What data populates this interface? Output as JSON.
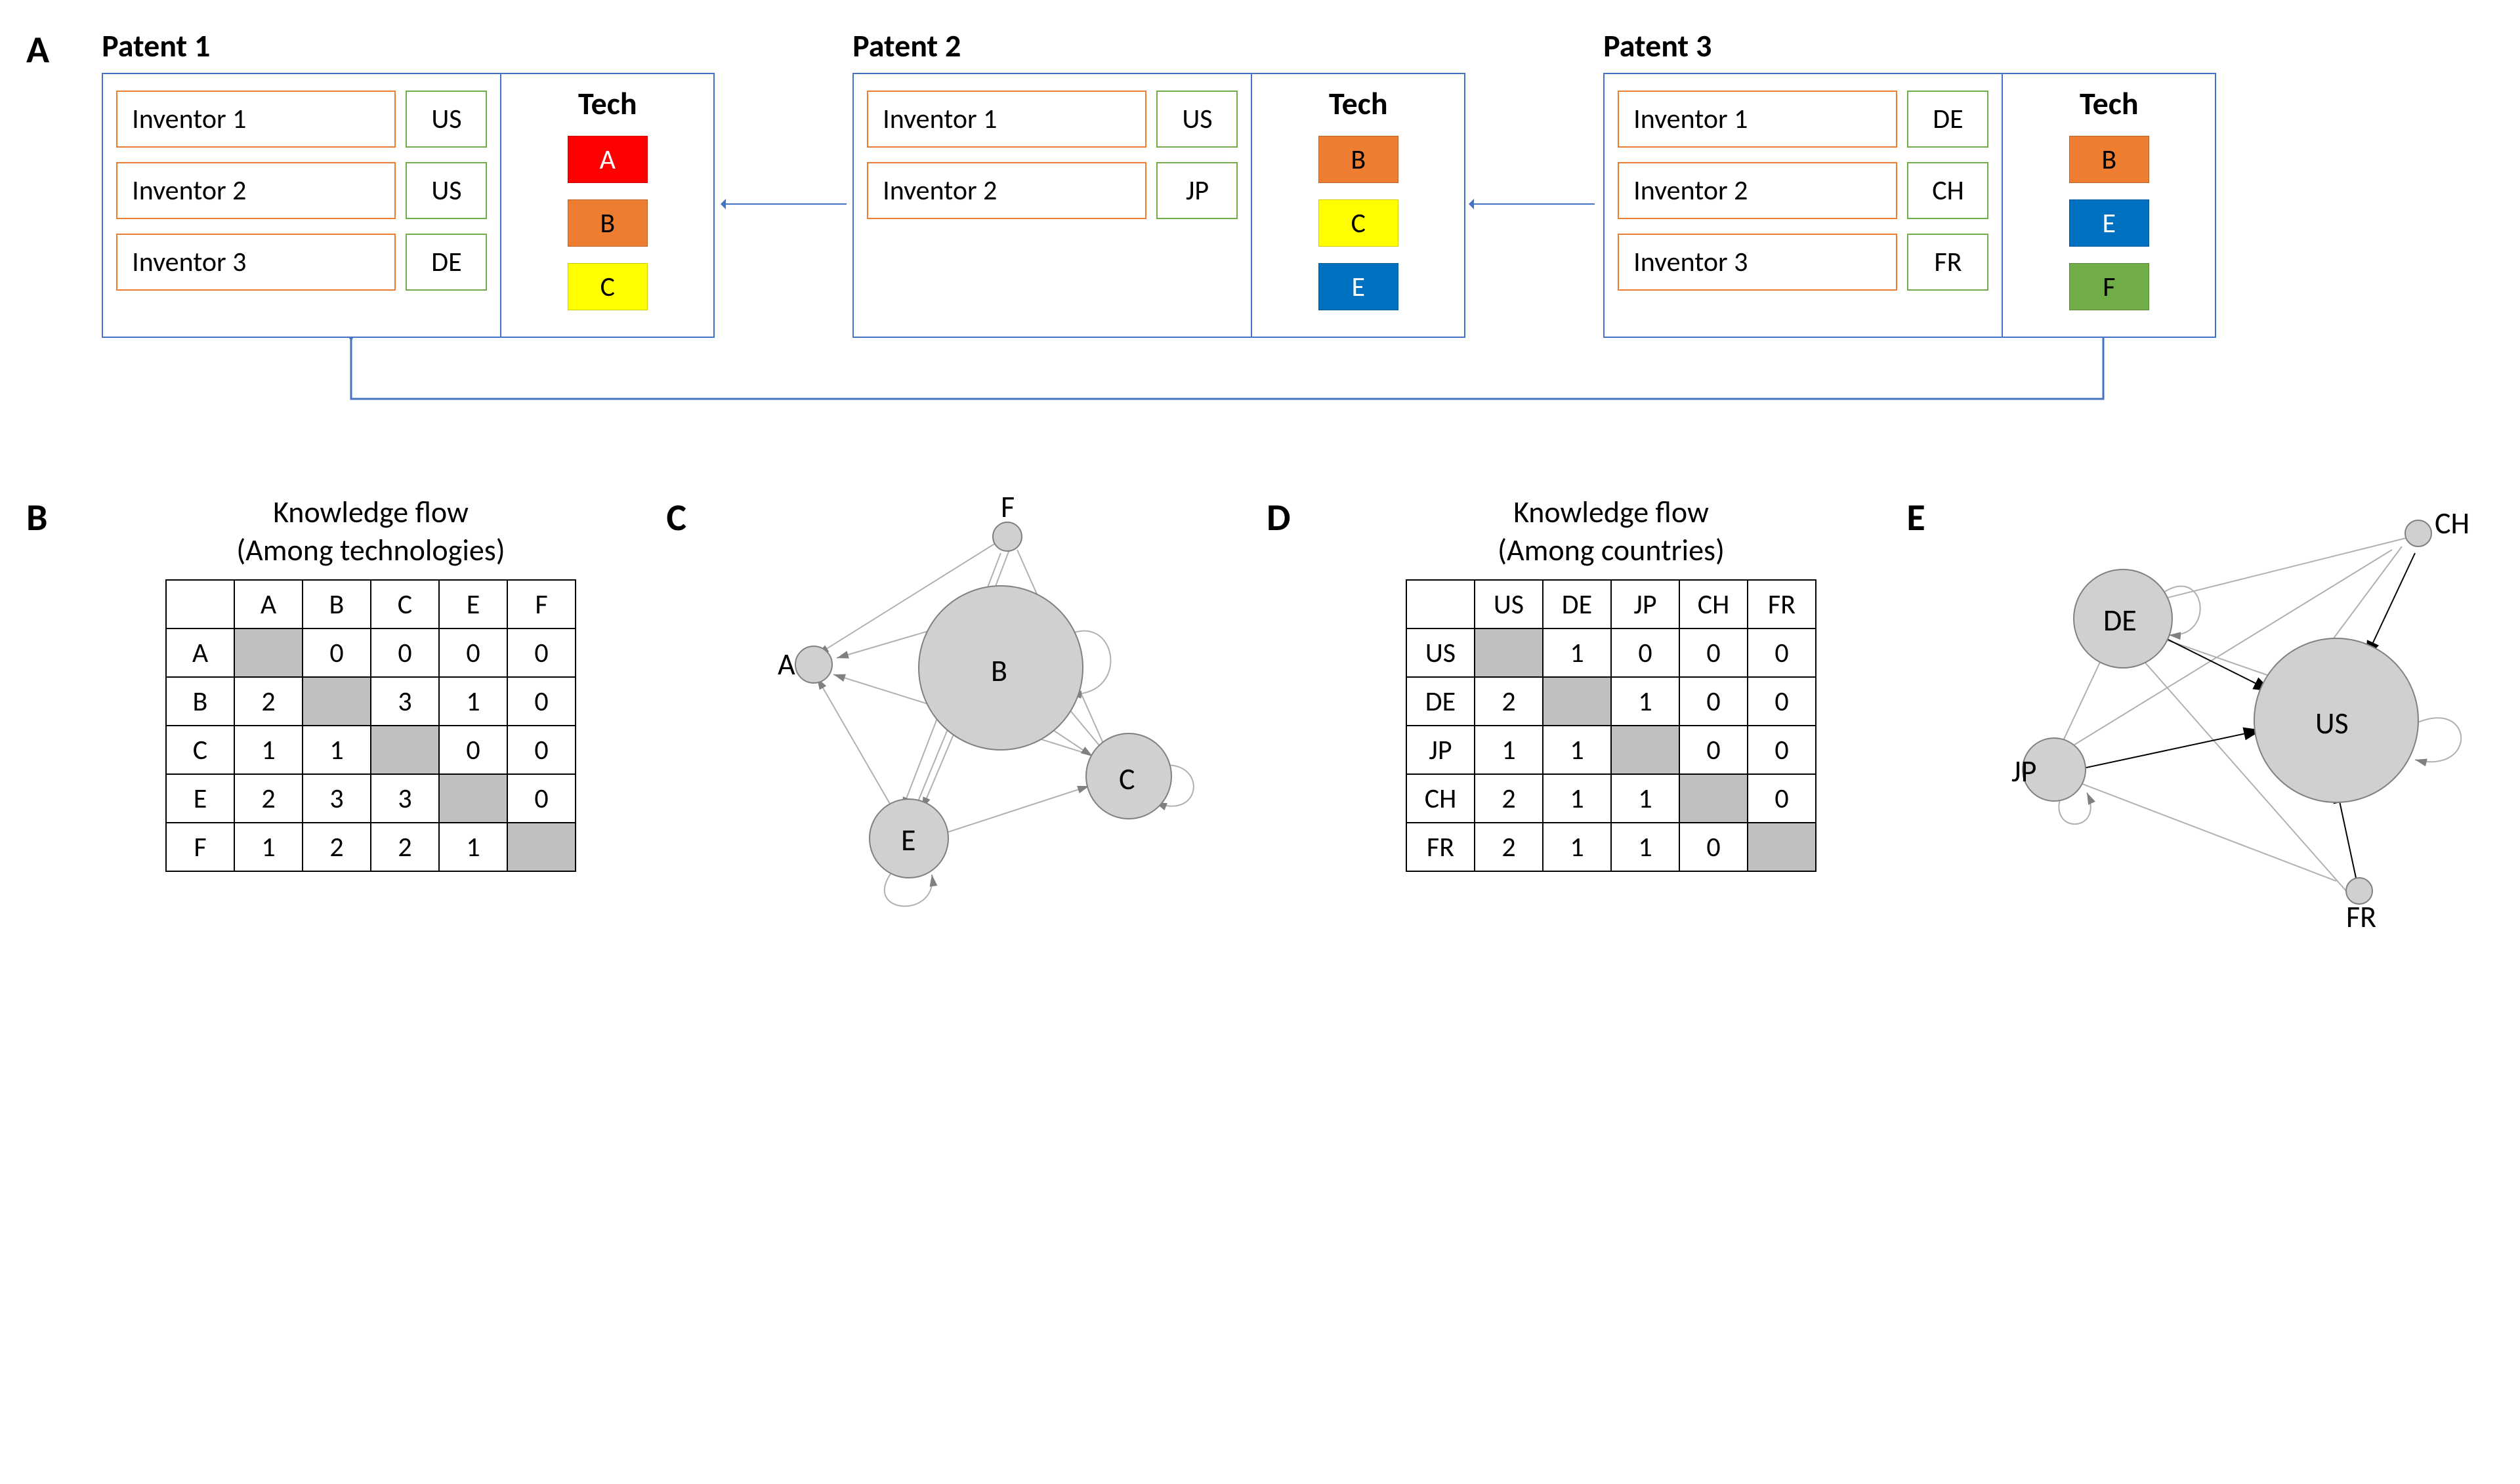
{
  "labels": {
    "A": "A",
    "B": "B",
    "C": "C",
    "D": "D",
    "E": "E"
  },
  "panelA": {
    "patents": [
      {
        "title": "Patent 1",
        "inventors": [
          {
            "name": "Inventor 1",
            "country": "US"
          },
          {
            "name": "Inventor 2",
            "country": "US"
          },
          {
            "name": "Inventor 3",
            "country": "DE"
          }
        ],
        "tech_header": "Tech",
        "tech": [
          {
            "label": "A",
            "class": "tA"
          },
          {
            "label": "B",
            "class": "tB"
          },
          {
            "label": "C",
            "class": "tC"
          }
        ]
      },
      {
        "title": "Patent 2",
        "inventors": [
          {
            "name": "Inventor 1",
            "country": "US"
          },
          {
            "name": "Inventor 2",
            "country": "JP"
          }
        ],
        "tech_header": "Tech",
        "tech": [
          {
            "label": "B",
            "class": "tB"
          },
          {
            "label": "C",
            "class": "tC"
          },
          {
            "label": "E",
            "class": "tE"
          }
        ]
      },
      {
        "title": "Patent 3",
        "inventors": [
          {
            "name": "Inventor 1",
            "country": "DE"
          },
          {
            "name": "Inventor 2",
            "country": "CH"
          },
          {
            "name": "Inventor 3",
            "country": "FR"
          }
        ],
        "tech_header": "Tech",
        "tech": [
          {
            "label": "B",
            "class": "tB"
          },
          {
            "label": "E",
            "class": "tE"
          },
          {
            "label": "F",
            "class": "tF"
          }
        ]
      }
    ],
    "citations": [
      {
        "from": "Patent 2",
        "to": "Patent 1"
      },
      {
        "from": "Patent 3",
        "to": "Patent 2"
      },
      {
        "from": "Patent 3",
        "to": "Patent 1"
      }
    ]
  },
  "panelB": {
    "title_line1": "Knowledge flow",
    "title_line2": "(Among technologies)",
    "headers": [
      "A",
      "B",
      "C",
      "E",
      "F"
    ],
    "rows": [
      {
        "label": "A",
        "cells": [
          null,
          0,
          0,
          0,
          0
        ]
      },
      {
        "label": "B",
        "cells": [
          2,
          null,
          3,
          1,
          0
        ]
      },
      {
        "label": "C",
        "cells": [
          1,
          1,
          null,
          0,
          0
        ]
      },
      {
        "label": "E",
        "cells": [
          2,
          3,
          3,
          null,
          0
        ]
      },
      {
        "label": "F",
        "cells": [
          1,
          2,
          2,
          1,
          null
        ]
      }
    ]
  },
  "panelC": {
    "nodes": [
      "A",
      "B",
      "C",
      "E",
      "F"
    ]
  },
  "panelD": {
    "title_line1": "Knowledge flow",
    "title_line2": "(Among countries)",
    "headers": [
      "US",
      "DE",
      "JP",
      "CH",
      "FR"
    ],
    "rows": [
      {
        "label": "US",
        "cells": [
          null,
          1,
          0,
          0,
          0
        ]
      },
      {
        "label": "DE",
        "cells": [
          2,
          null,
          1,
          0,
          0
        ]
      },
      {
        "label": "JP",
        "cells": [
          1,
          1,
          null,
          0,
          0
        ]
      },
      {
        "label": "CH",
        "cells": [
          2,
          1,
          1,
          null,
          0
        ]
      },
      {
        "label": "FR",
        "cells": [
          2,
          1,
          1,
          0,
          null
        ]
      }
    ]
  },
  "panelE": {
    "nodes": [
      "US",
      "DE",
      "JP",
      "CH",
      "FR"
    ]
  },
  "chart_data": [
    {
      "type": "table",
      "title": "Knowledge flow (Among technologies)",
      "row_labels": [
        "A",
        "B",
        "C",
        "E",
        "F"
      ],
      "col_labels": [
        "A",
        "B",
        "C",
        "E",
        "F"
      ],
      "values": [
        [
          null,
          0,
          0,
          0,
          0
        ],
        [
          2,
          null,
          3,
          1,
          0
        ],
        [
          1,
          1,
          null,
          0,
          0
        ],
        [
          2,
          3,
          3,
          null,
          0
        ],
        [
          1,
          2,
          2,
          1,
          null
        ]
      ],
      "note": "diagonal undefined (grey)"
    },
    {
      "type": "table",
      "title": "Knowledge flow (Among countries)",
      "row_labels": [
        "US",
        "DE",
        "JP",
        "CH",
        "FR"
      ],
      "col_labels": [
        "US",
        "DE",
        "JP",
        "CH",
        "FR"
      ],
      "values": [
        [
          null,
          1,
          0,
          0,
          0
        ],
        [
          2,
          null,
          1,
          0,
          0
        ],
        [
          1,
          1,
          null,
          0,
          0
        ],
        [
          2,
          1,
          1,
          null,
          0
        ],
        [
          2,
          1,
          1,
          0,
          null
        ]
      ],
      "note": "diagonal undefined (grey)"
    }
  ]
}
